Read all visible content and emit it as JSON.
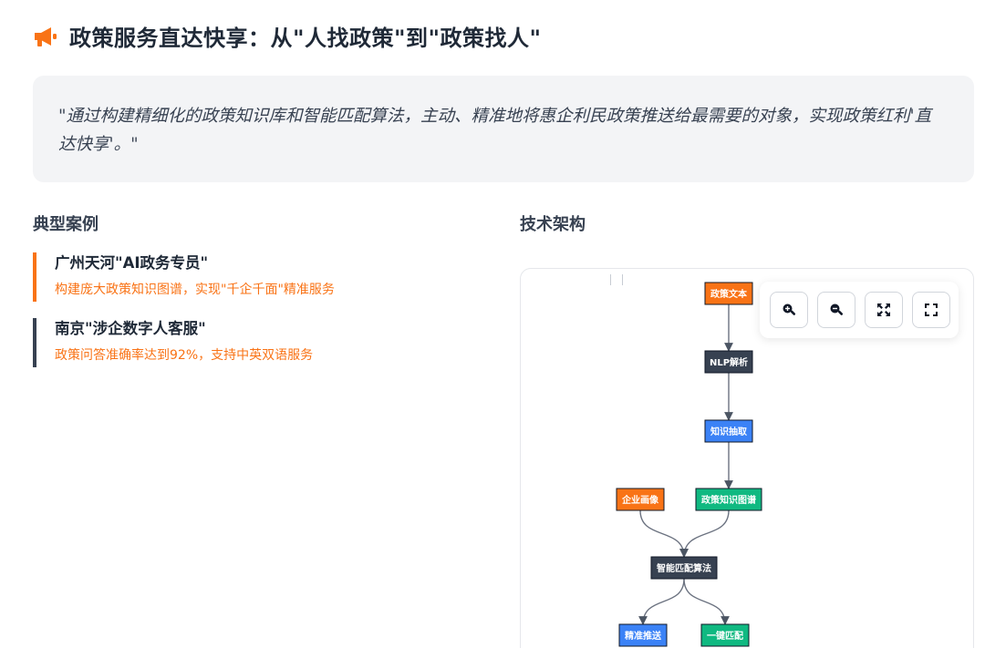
{
  "header": {
    "title": "政策服务直达快享：从\"人找政策\"到\"政策找人\"",
    "icon": "megaphone-icon",
    "accent": "#f97316"
  },
  "quote": {
    "text": "\"通过构建精细化的政策知识库和智能匹配算法，主动、精准地将惠企利民政策推送给最需要的对象，实现政策红利'直达快享'。\""
  },
  "cases": {
    "heading": "典型案例",
    "items": [
      {
        "title": "广州天河\"AI政务专员\"",
        "desc": "构建庞大政策知识图谱，实现\"千企千面\"精准服务",
        "border": "#f97316"
      },
      {
        "title": "南京\"涉企数字人客服\"",
        "desc": "政策问答准确率达到92%，支持中英双语服务",
        "border": "#374151"
      }
    ]
  },
  "architecture": {
    "heading": "技术架构",
    "controls": [
      {
        "name": "zoom-in",
        "icon": "zoom-in-icon"
      },
      {
        "name": "zoom-out",
        "icon": "zoom-out-icon"
      },
      {
        "name": "fit",
        "icon": "fit-view-icon"
      },
      {
        "name": "fullscreen",
        "icon": "fullscreen-icon"
      }
    ],
    "nodes": [
      {
        "id": "doc",
        "label": "政策文本",
        "color": "#f97316"
      },
      {
        "id": "nlp",
        "label": "NLP解析",
        "color": "#374151"
      },
      {
        "id": "extract",
        "label": "知识抽取",
        "color": "#3b82f6"
      },
      {
        "id": "profile",
        "label": "企业画像",
        "color": "#f97316"
      },
      {
        "id": "graph",
        "label": "政策知识图谱",
        "color": "#10b981"
      },
      {
        "id": "match",
        "label": "智能匹配算法",
        "color": "#374151"
      },
      {
        "id": "push",
        "label": "精准推送",
        "color": "#3b82f6"
      },
      {
        "id": "onekey",
        "label": "一键匹配",
        "color": "#10b981"
      }
    ],
    "edges": [
      [
        "doc",
        "nlp"
      ],
      [
        "nlp",
        "extract"
      ],
      [
        "extract",
        "graph"
      ],
      [
        "profile",
        "match"
      ],
      [
        "graph",
        "match"
      ],
      [
        "match",
        "push"
      ],
      [
        "match",
        "onekey"
      ]
    ]
  }
}
